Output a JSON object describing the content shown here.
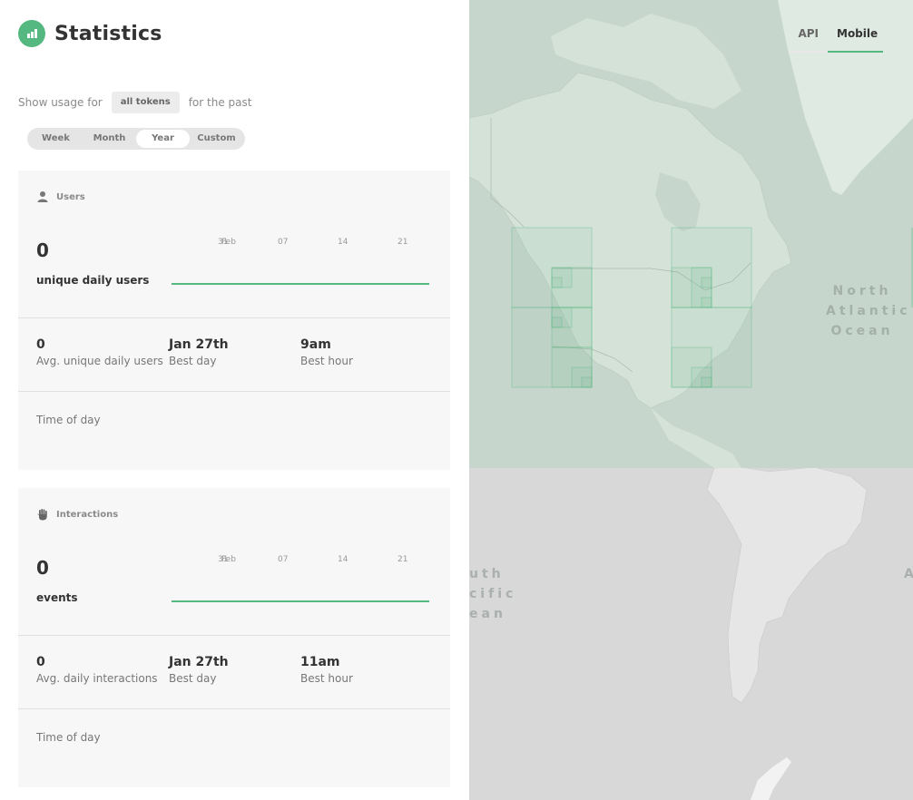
{
  "header": {
    "title": "Statistics",
    "icon": "bar-chart-icon"
  },
  "filters": {
    "show_usage_for": "Show usage for",
    "token_selector": "all tokens",
    "for_the_past": "for the past",
    "ranges": [
      "Week",
      "Month",
      "Year",
      "Custom"
    ],
    "selected_range": "Year"
  },
  "users": {
    "title": "Users",
    "icon": "user-icon",
    "total": "0",
    "total_label": "unique daily users",
    "chart_ticks": [
      "31",
      "Feb",
      "07",
      "14",
      "21"
    ],
    "stats": [
      {
        "value": "0",
        "label": "Avg. unique daily users"
      },
      {
        "value": "Jan 27th",
        "label": "Best day"
      },
      {
        "value": "9am",
        "label": "Best hour"
      }
    ],
    "time_of_day": "Time of day"
  },
  "interactions": {
    "title": "Interactions",
    "icon": "hand-icon",
    "total": "0",
    "total_label": "events",
    "chart_ticks": [
      "31",
      "Feb",
      "07",
      "14",
      "21"
    ],
    "stats": [
      {
        "value": "0",
        "label": "Avg. daily interactions"
      },
      {
        "value": "Jan 27th",
        "label": "Best day"
      },
      {
        "value": "11am",
        "label": "Best hour"
      }
    ],
    "time_of_day": "Time of day"
  },
  "map": {
    "tabs": [
      "API",
      "Mobile"
    ],
    "active_tab": "Mobile",
    "labels": {
      "north_atlantic": [
        "North",
        "Atlantic",
        "Ocean"
      ],
      "south_pacific": [
        "uth",
        "cific",
        "ean"
      ],
      "atlantic_partial": "A"
    },
    "accent_color": "#56b881"
  },
  "colors": {
    "accent": "#56b881",
    "card_bg": "#f7f7f7"
  }
}
